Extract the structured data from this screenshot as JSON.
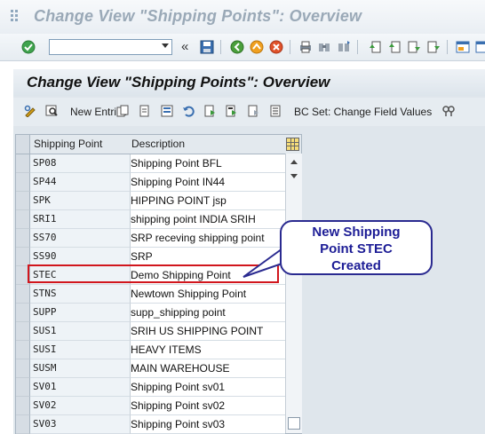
{
  "window": {
    "title": "Change View \"Shipping Points\": Overview"
  },
  "std_toolbar": {
    "command_field_value": "",
    "icons": [
      "enter-icon",
      "command-dropdown",
      "back-nav-icon",
      "save-icon",
      "back-icon",
      "exit-icon",
      "cancel-icon",
      "print-icon",
      "find-icon",
      "find-next-icon",
      "first-page-icon",
      "previous-page-icon",
      "next-page-icon",
      "last-page-icon",
      "new-session-icon",
      "shortcut-icon"
    ]
  },
  "view": {
    "title": "Change View \"Shipping Points\": Overview"
  },
  "app_toolbar": {
    "new_entries_label": "New Entries",
    "bc_set_label": "BC Set: Change Field Values"
  },
  "table": {
    "headers": {
      "code": "Shipping Point",
      "desc": "Description"
    },
    "rows": [
      {
        "code": "SP08",
        "desc": "Shipping Point BFL"
      },
      {
        "code": "SP44",
        "desc": "Shipping Point IN44"
      },
      {
        "code": "SPK",
        "desc": " HIPPING POINT jsp"
      },
      {
        "code": "SRI1",
        "desc": "shipping point INDIA SRIH"
      },
      {
        "code": "SS70",
        "desc": "SRP receving shipping point"
      },
      {
        "code": "SS90",
        "desc": "SRP"
      },
      {
        "code": "STEC",
        "desc": "Demo Shipping Point"
      },
      {
        "code": "STNS",
        "desc": "Newtown Shipping Point"
      },
      {
        "code": "SUPP",
        "desc": "supp_shipping point"
      },
      {
        "code": "SUS1",
        "desc": "SRIH US SHIPPING POINT"
      },
      {
        "code": "SUSI",
        "desc": "HEAVY ITEMS"
      },
      {
        "code": "SUSM",
        "desc": "MAIN WAREHOUSE"
      },
      {
        "code": "SV01",
        "desc": "Shipping Point sv01"
      },
      {
        "code": "SV02",
        "desc": "Shipping Point sv02"
      },
      {
        "code": "SV03",
        "desc": "Shipping Point sv03"
      }
    ]
  },
  "callout": {
    "line1": "New Shipping",
    "line2": "Point STEC",
    "line3": "Created"
  },
  "colors": {
    "highlight": "#d1161d",
    "callout_border": "#2a2a90",
    "callout_text": "#1d1d96"
  }
}
